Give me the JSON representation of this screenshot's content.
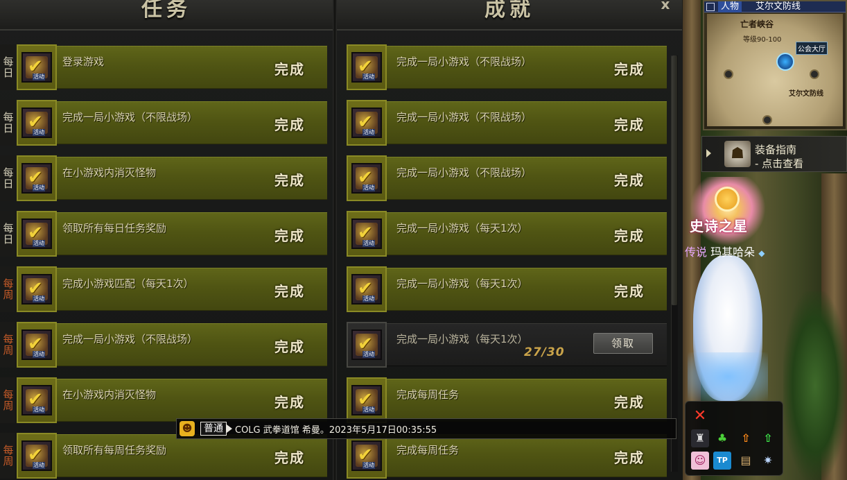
{
  "headers": {
    "left": "任务",
    "right": "成就",
    "close": "x"
  },
  "left_rows": [
    {
      "tag": "每日",
      "tag_type": "daily",
      "name": "登录游戏",
      "status": "完成",
      "icon": "check-icon"
    },
    {
      "tag": "每日",
      "tag_type": "daily",
      "name": "完成一局小游戏（不限战场）",
      "status": "完成",
      "icon": "check-icon"
    },
    {
      "tag": "每日",
      "tag_type": "daily",
      "name": "在小游戏内消灭怪物",
      "status": "完成",
      "icon": "check-icon"
    },
    {
      "tag": "每日",
      "tag_type": "daily",
      "name": "领取所有每日任务奖励",
      "status": "完成",
      "icon": "check-icon"
    },
    {
      "tag": "每周",
      "tag_type": "weekly",
      "name": "完成小游戏匹配（每天1次）",
      "status": "完成",
      "icon": "check-icon"
    },
    {
      "tag": "每周",
      "tag_type": "weekly",
      "name": "完成一局小游戏（不限战场）",
      "status": "完成",
      "icon": "check-icon"
    },
    {
      "tag": "每周",
      "tag_type": "weekly",
      "name": "在小游戏内消灭怪物",
      "status": "完成",
      "icon": "check-icon"
    },
    {
      "tag": "每周",
      "tag_type": "weekly",
      "name": "领取所有每周任务奖励",
      "status": "完成",
      "icon": "check-icon"
    }
  ],
  "right_rows": [
    {
      "name": "完成一局小游戏（不限战场）",
      "status": "完成",
      "icon": "check-icon"
    },
    {
      "name": "完成一局小游戏（不限战场）",
      "status": "完成",
      "icon": "check-icon"
    },
    {
      "name": "完成一局小游戏（不限战场）",
      "status": "完成",
      "icon": "check-icon"
    },
    {
      "name": "完成一局小游戏（每天1次）",
      "status": "完成",
      "icon": "check-icon"
    },
    {
      "name": "完成一局小游戏（每天1次）",
      "status": "完成",
      "icon": "check-icon"
    },
    {
      "name": "完成一局小游戏（每天1次）",
      "status": "",
      "progress": "27/30",
      "button": "领取",
      "icon": "check-icon"
    },
    {
      "name": "完成每周任务",
      "status": "完成",
      "icon": "check-icon"
    },
    {
      "name": "完成每周任务",
      "status": "完成",
      "icon": "check-icon"
    }
  ],
  "icon_badge_label": "活动",
  "chat": {
    "channel": "普通",
    "message": "COLG 武拳道馆 希曼。2023年5月17日00:35:55"
  },
  "minimap": {
    "tab_people": "人物",
    "title": "艾尔文防线",
    "zone": "亡者峡谷",
    "level": "等级90-100",
    "guild_hall": "公会大厅",
    "defense": "艾尔文防线"
  },
  "guide": {
    "title": "装备指南",
    "subtitle": "- 点击查看"
  },
  "emblem_text": "史诗之星",
  "character": {
    "prefix": "传说",
    "name": "玛其哈朵",
    "gem": "◆"
  },
  "colors": {
    "row_bar": "#505513",
    "icon_frame": "#8a8a25",
    "weekly_tag": "#c85c28",
    "progress": "#caa44a"
  }
}
